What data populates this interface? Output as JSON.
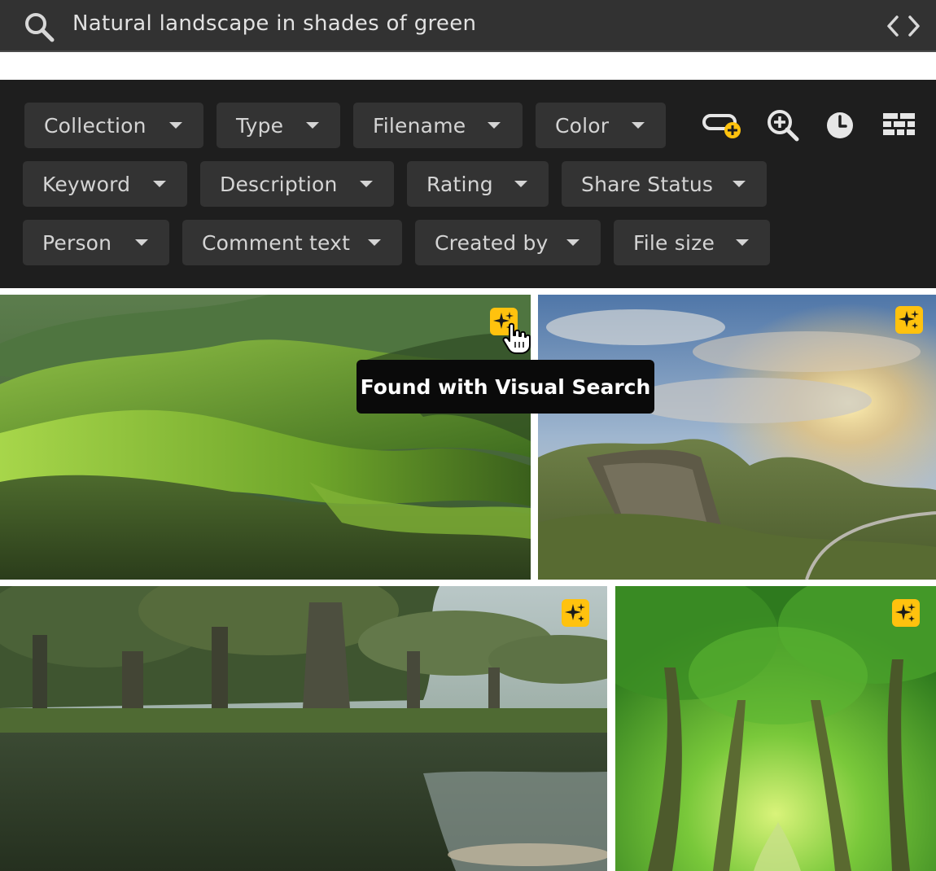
{
  "search": {
    "query": "Natural landscape in shades of green",
    "search_icon": "search-icon",
    "toggle_icon": "code-brackets-icon"
  },
  "filters": {
    "rows": [
      [
        "Collection",
        "Type",
        "Filename",
        "Color"
      ],
      [
        "Keyword",
        "Description",
        "Rating",
        "Share Status"
      ],
      [
        "Person",
        "Comment text",
        "Created by",
        "File size"
      ]
    ],
    "tools": [
      {
        "icon": "add-filter-icon"
      },
      {
        "icon": "zoom-in-icon"
      },
      {
        "icon": "recent-history-icon"
      },
      {
        "icon": "masonry-grid-icon"
      }
    ]
  },
  "results": {
    "tooltip": "Found with Visual Search",
    "badge_icon": "visual-search-sparkle-icon",
    "images": [
      {
        "name": "green-rolling-hills"
      },
      {
        "name": "mountain-cliff-sunset"
      },
      {
        "name": "cypress-swamp"
      },
      {
        "name": "green-forest-path"
      }
    ]
  },
  "colors": {
    "search_bar": "#323232",
    "filter_panel": "#1e1e1e",
    "chip": "#333333",
    "chip_text": "#d4d4d4",
    "badge": "#ffc20e",
    "tooltip_bg": "#0a0a0a"
  }
}
